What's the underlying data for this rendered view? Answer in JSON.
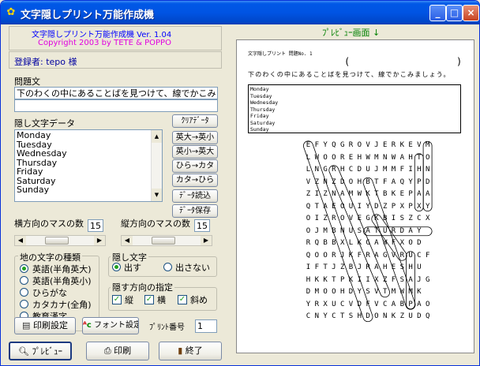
{
  "window": {
    "title": "文字隠しプリント万能作成機",
    "controls": {
      "minimize": "_",
      "maximize": "□",
      "close": "×"
    }
  },
  "header": {
    "line1": "文字隠しプリント万能作成機 Ver. 1.04",
    "line2": "Copyright 2003 by TETE & POPPO",
    "line1_color": "#0000ff",
    "line2_color": "#e000e0"
  },
  "registrant": "登録者: tepo 様",
  "question": {
    "label": "問題文",
    "text": "下のわくの中にあることばを見つけて、線でかこみましょう",
    "text2": ""
  },
  "hidden_data": {
    "label": "隠し文字データ",
    "items": [
      "Monday",
      "Tuesday",
      "Wednesday",
      "Thursday",
      "Friday",
      "Saturday",
      "Sunday"
    ]
  },
  "side_buttons": [
    "ｸﾘｱﾃﾞｰﾀ",
    "英大→英小",
    "英小→英大",
    "ひら→カタ",
    "カタ→ひら",
    "ﾃﾞｰﾀ読込",
    "ﾃﾞｰﾀ保存"
  ],
  "grid_size": {
    "h_label": "横方向のマスの数",
    "h_value": "15",
    "v_label": "縦方向のマスの数",
    "v_value": "15"
  },
  "fill_type": {
    "label": "地の文字の種類",
    "options": [
      "英語(半角英大)",
      "英語(半角英小)",
      "ひらがな",
      "カタカナ(全角)",
      "教育漢字"
    ],
    "selected": 0
  },
  "hide_text": {
    "label": "隠し文字",
    "options": [
      "出す",
      "出さない"
    ],
    "selected": 0
  },
  "direction": {
    "label": "隠す方向の指定",
    "options": [
      "縦",
      "横",
      "斜め"
    ]
  },
  "bottom": {
    "print_setup": "印刷設定",
    "font_setup": "フォント設定",
    "print_no_label": "ﾌﾟﾘﾝﾄ番号",
    "print_no": "1",
    "preview": "ﾌﾟﾚﾋﾞｭｰ",
    "print": "印刷",
    "exit": "終了"
  },
  "preview": {
    "label": "ﾌﾟﾚﾋﾞｭｰ画面 ↓",
    "doc_title": "文字隠しプリント 問題No. 1",
    "paren_open": "(",
    "paren_close": ")",
    "question": "下のわくの中にあることばを見つけて、線でかこみましょう。",
    "words": [
      "Monday",
      "Tuesday",
      "Wednesday",
      "Thursday",
      "Friday",
      "Saturday",
      "Sunday"
    ],
    "grid": [
      "EFYQGROVJERKEVM",
      "LWOOREHWMNWAHTO",
      "LNGRHCDUJMMFIHN",
      "VZNZDOHBTFAQYPD",
      "ZIZNAMWKTBKEPAA",
      "QTAEOUIYDZPXPXY",
      "OIZROVEGKBISZCX",
      "OJMBNUSATURDAY",
      "RQBBXLKGAWFXOD",
      "QOORJKFRAGVRUCF",
      "IFTJZBJRAHESHU",
      "HKKTPKIIXZFSAJG",
      "DMOOHDYSVTMWMK",
      "YRXUCVDFVCABPAO",
      "CNYCTSHDONKZUDQ"
    ]
  }
}
